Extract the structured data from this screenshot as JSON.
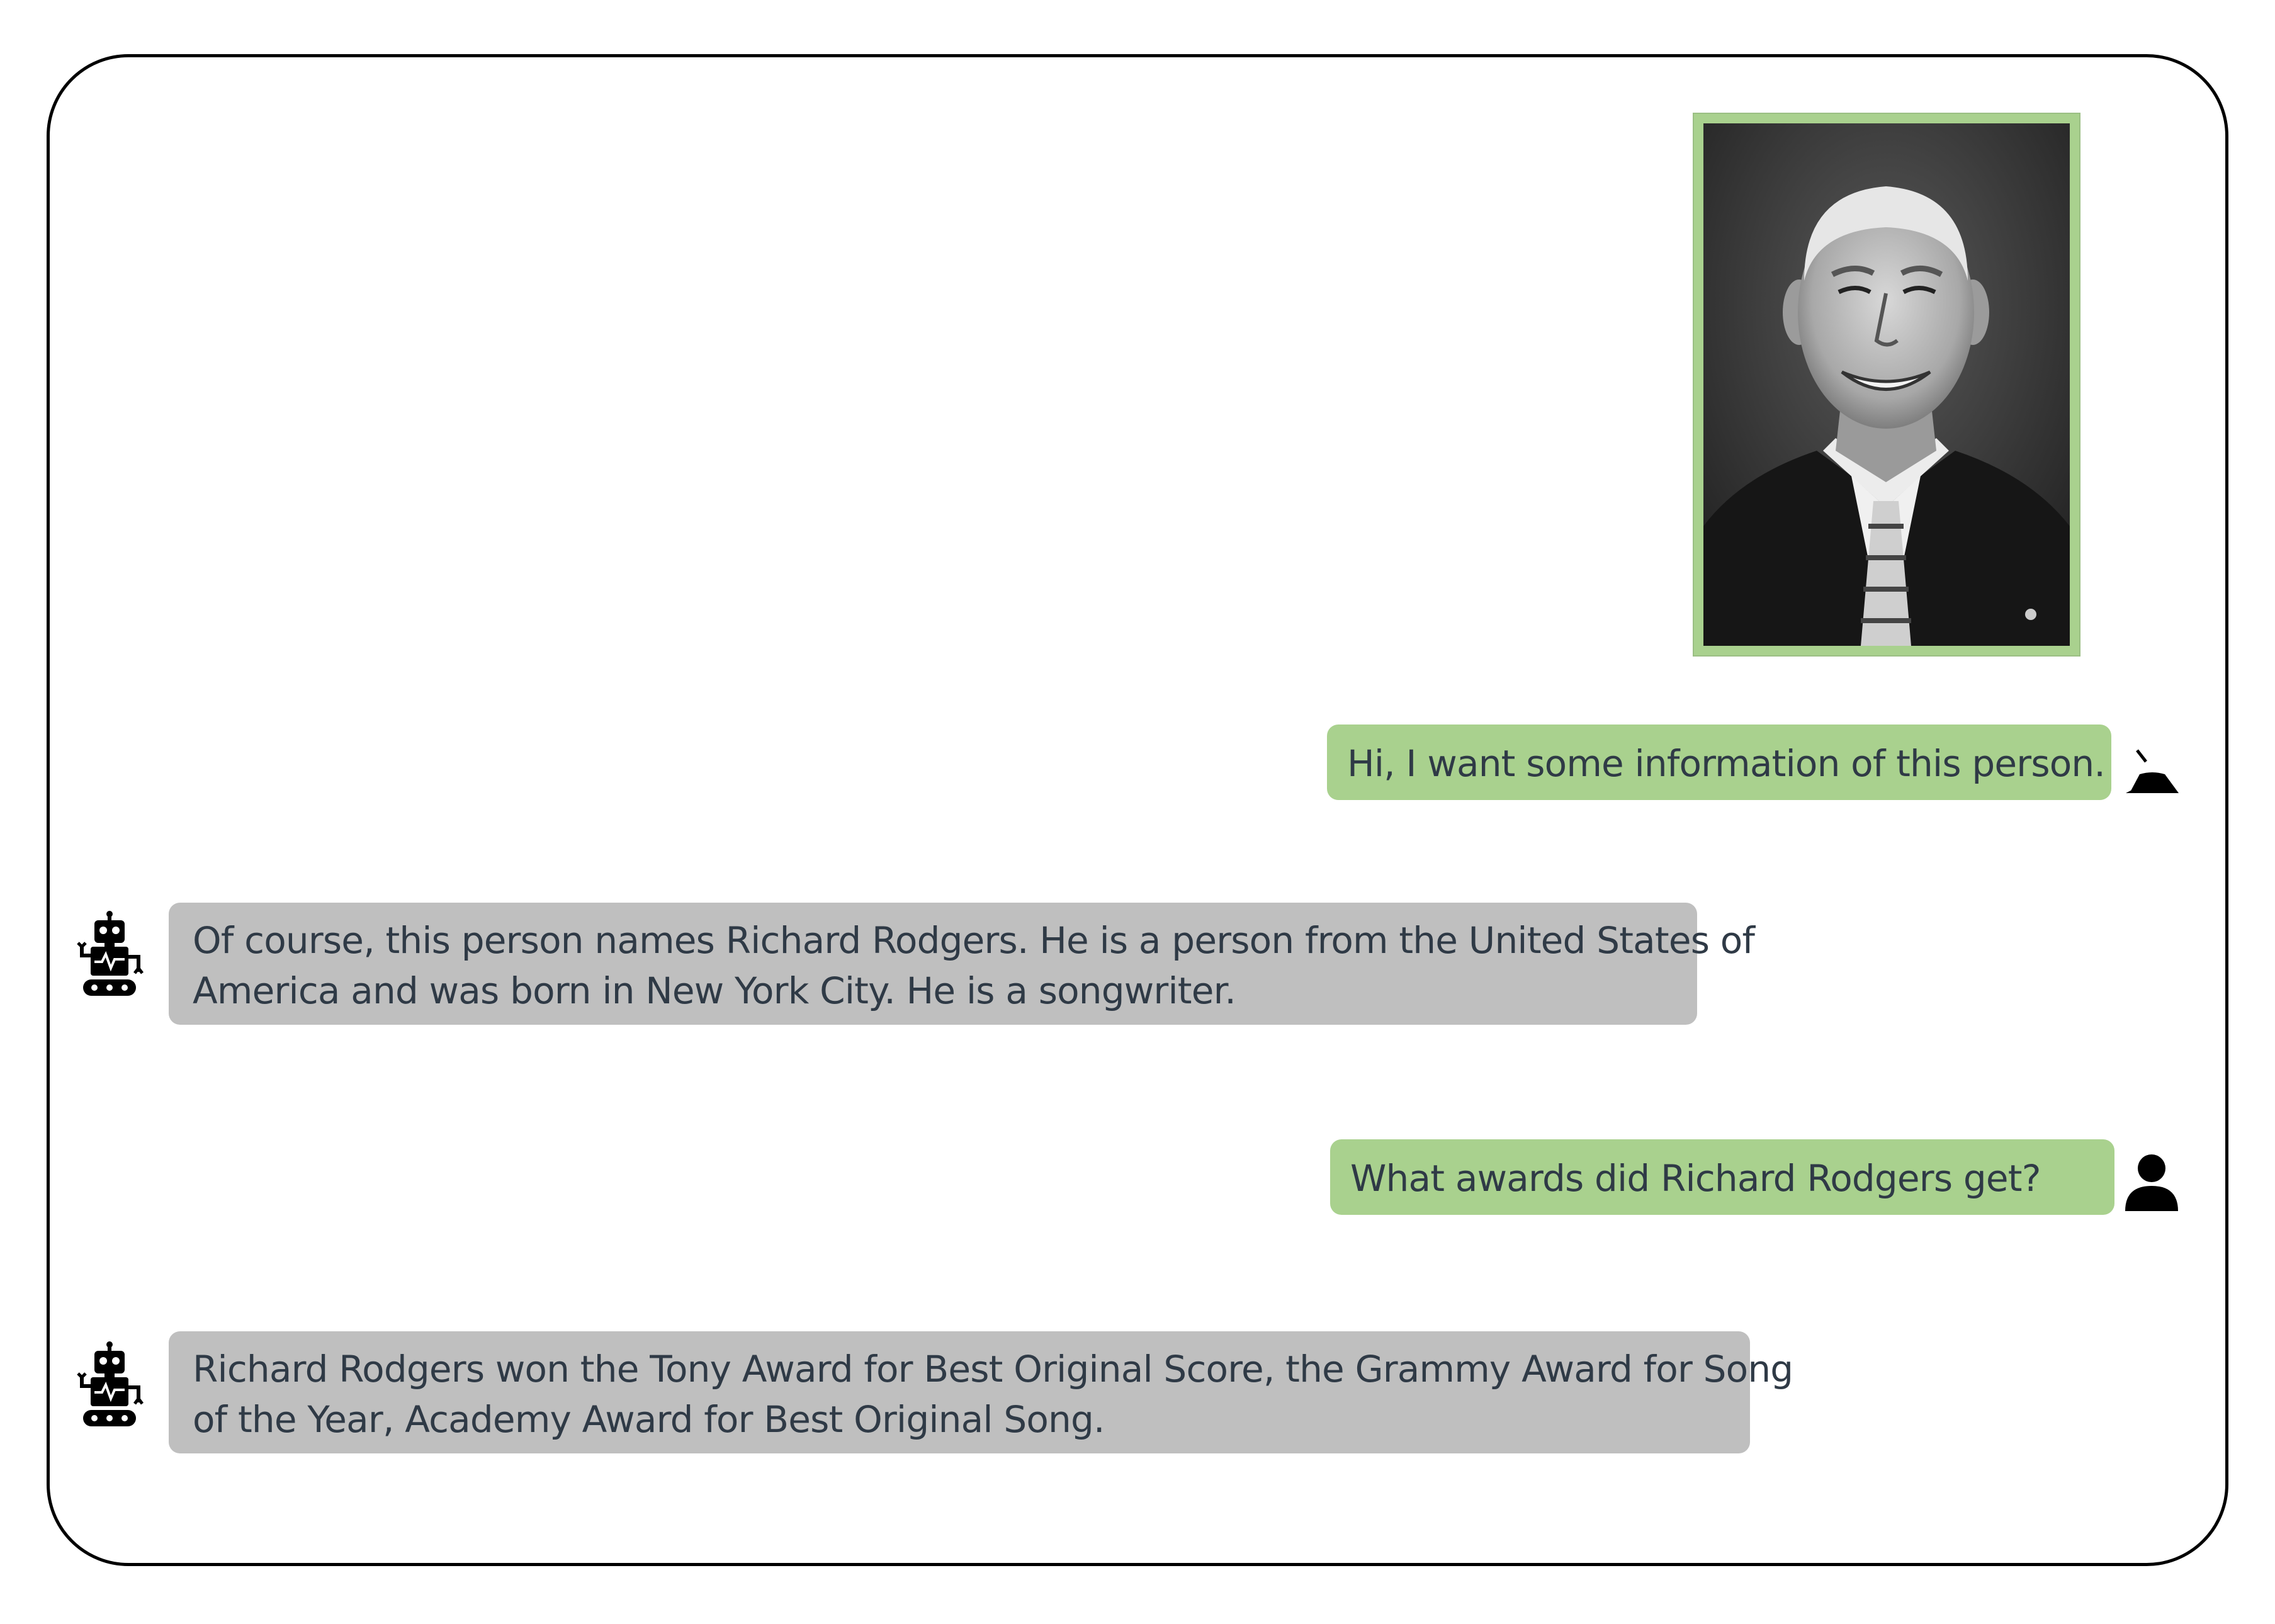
{
  "colors": {
    "frame_border": "#000000",
    "user_bubble": "#a9d18e",
    "bot_bubble": "#bfbfbf",
    "text": "#2f3a46",
    "photo_border": "#a9d18e"
  },
  "photo": {
    "icon": "person-portrait-photo"
  },
  "messages": [
    {
      "role": "user",
      "lines": [
        "Hi, I want some information of this person."
      ],
      "icon": "user-icon"
    },
    {
      "role": "assistant",
      "lines": [
        "Of course, this person names Richard Rodgers. He is a person from the United States of",
        "America and was born in New York City. He is a songwriter."
      ],
      "icon": "robot-icon"
    },
    {
      "role": "user",
      "lines": [
        "What awards did Richard Rodgers get?"
      ],
      "icon": "user-icon"
    },
    {
      "role": "assistant",
      "lines": [
        "Richard Rodgers won the Tony Award for Best Original Score, the Grammy Award for Song",
        "of the Year, Academy Award for Best Original Song."
      ],
      "icon": "robot-icon"
    }
  ]
}
